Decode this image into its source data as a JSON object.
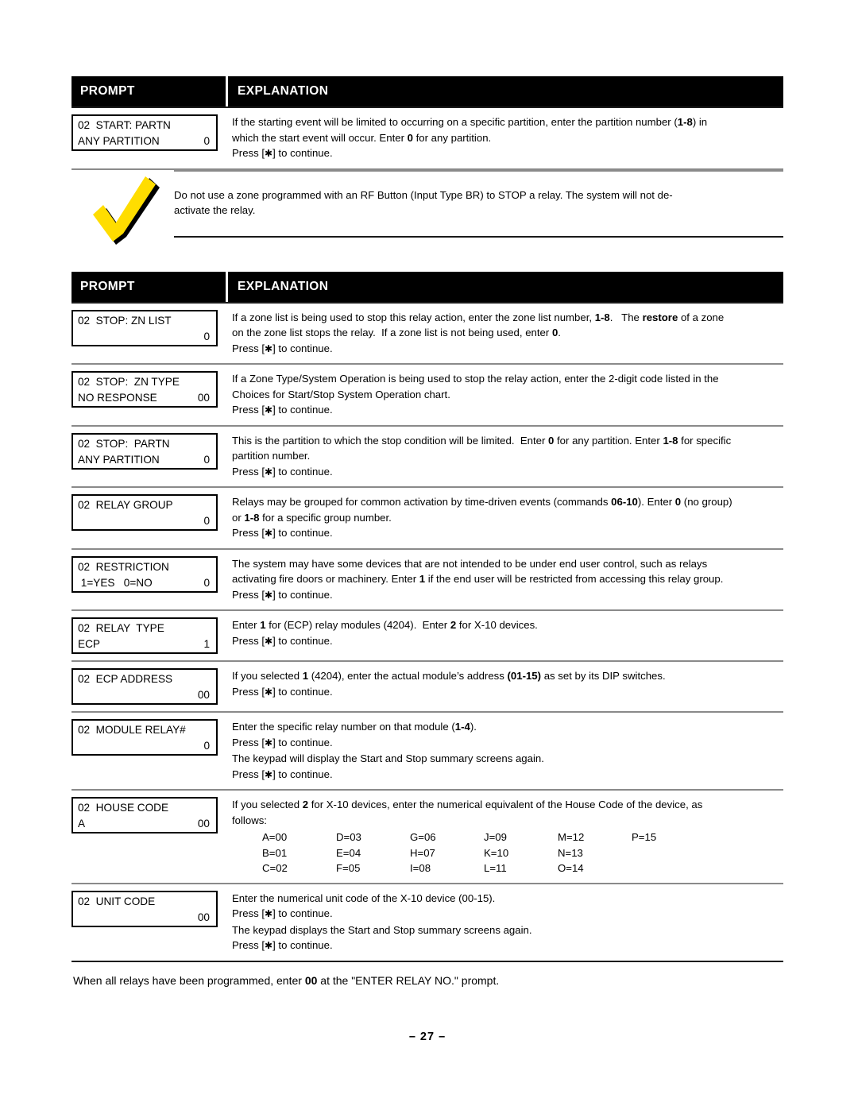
{
  "table_headers": {
    "prompt": "PROMPT",
    "explanation": "EXPLANATION"
  },
  "press_line": "Press [✱] to continue.",
  "section1": {
    "rows": [
      {
        "lcd": {
          "line1": "02  START: PARTN",
          "line2": "ANY PARTITION",
          "value2": "0"
        },
        "lines": [
          "If the starting event will be limited to occurring on a specific partition, enter the partition number (1-8) in",
          "which the start event will occur. Enter 0 for any partition.",
          "Press [✱] to continue."
        ]
      }
    ]
  },
  "warning": {
    "icon": "checkmark-icon",
    "icon_color": "#FFDD00",
    "lines": [
      "Do not use a zone programmed with an RF Button (Input Type BR) to STOP a relay. The system will not de-",
      "activate the relay."
    ]
  },
  "section2": {
    "rows": [
      {
        "lcd": {
          "line1": "02  STOP: ZN LIST",
          "line2": "",
          "value2": "0"
        },
        "lines": [
          "If a zone list is being used to stop this relay action, enter the zone list number, 1-8.   The restore of a zone",
          "on the zone list stops the relay.  If a zone list is not being used, enter 0.",
          "Press [✱] to continue."
        ]
      },
      {
        "lcd": {
          "line1": "02  STOP:  ZN TYPE",
          "line2": "NO RESPONSE",
          "value2": "00"
        },
        "lines": [
          "If a Zone Type/System Operation is being used to stop the relay action, enter the 2-digit code listed in the",
          "Choices for Start/Stop System Operation chart.",
          "Press [✱] to continue."
        ]
      },
      {
        "lcd": {
          "line1": "02  STOP:  PARTN",
          "line2": "ANY PARTITION",
          "value2": "0"
        },
        "lines": [
          "This is the partition to which the stop condition will be limited.  Enter 0 for any partition. Enter 1-8 for specific",
          "partition number.",
          "Press [✱] to continue."
        ]
      },
      {
        "lcd": {
          "line1": "02  RELAY GROUP",
          "line2": "",
          "value2": "0"
        },
        "lines": [
          "Relays may be grouped for common activation by time-driven events (commands 06-10). Enter 0 (no group)",
          "or 1-8 for a specific group number.",
          "Press [✱] to continue."
        ]
      },
      {
        "lcd": {
          "line1": "02  RESTRICTION",
          "line2": " 1=YES   0=NO",
          "value2": "0"
        },
        "lines": [
          "The system may have some devices that are not intended to be under end user control, such as relays",
          "activating fire doors or machinery. Enter 1 if the end user will be restricted from accessing this relay group.",
          "Press [✱] to continue."
        ]
      },
      {
        "lcd": {
          "line1": "02  RELAY  TYPE",
          "line2": "ECP",
          "value2": "1"
        },
        "lines": [
          "Enter 1 for (ECP) relay modules (4204).  Enter 2 for X-10 devices.",
          "Press [✱] to continue."
        ]
      },
      {
        "lcd": {
          "line1": "02  ECP ADDRESS",
          "line2": "",
          "value2": "00"
        },
        "lines": [
          "If you selected 1 (4204), enter the actual module’s address (01-15) as set by its DIP switches.",
          "Press [✱] to continue."
        ]
      },
      {
        "lcd": {
          "line1": "02  MODULE RELAY#",
          "line2": "",
          "value2": "0"
        },
        "lines": [
          "Enter the specific relay number on that module (1-4).",
          "Press [✱] to continue.",
          "The keypad will display the Start and Stop summary screens again.",
          "Press [✱] to continue."
        ]
      }
    ]
  },
  "house_code_row": {
    "lcd": {
      "line1": "02  HOUSE CODE",
      "line2": "A",
      "value2": "00"
    },
    "lines": [
      "If you selected 2 for X-10 devices, enter the numerical equivalent of the House Code of the device, as",
      "follows:"
    ],
    "grid": [
      [
        "A=00",
        "D=03",
        "G=06",
        "J=09",
        "M=12",
        "P=15"
      ],
      [
        "B=01",
        "E=04",
        "H=07",
        "K=10",
        "N=13",
        ""
      ],
      [
        "C=02",
        "F=05",
        "I=08",
        "L=11",
        "O=14",
        ""
      ]
    ]
  },
  "unit_code_row": {
    "lcd": {
      "line1": "02  UNIT CODE",
      "line2": "",
      "value2": "00"
    },
    "lines": [
      "Enter the numerical unit code of the X-10 device (00-15).",
      "Press [✱] to continue.",
      "The keypad displays the Start and Stop summary screens again.",
      "Press [✱] to continue."
    ]
  },
  "footer": {
    "note": "When all relays have been programmed, enter 00 at the \"ENTER RELAY NO.\" prompt.",
    "page_number": "– 27 –"
  }
}
